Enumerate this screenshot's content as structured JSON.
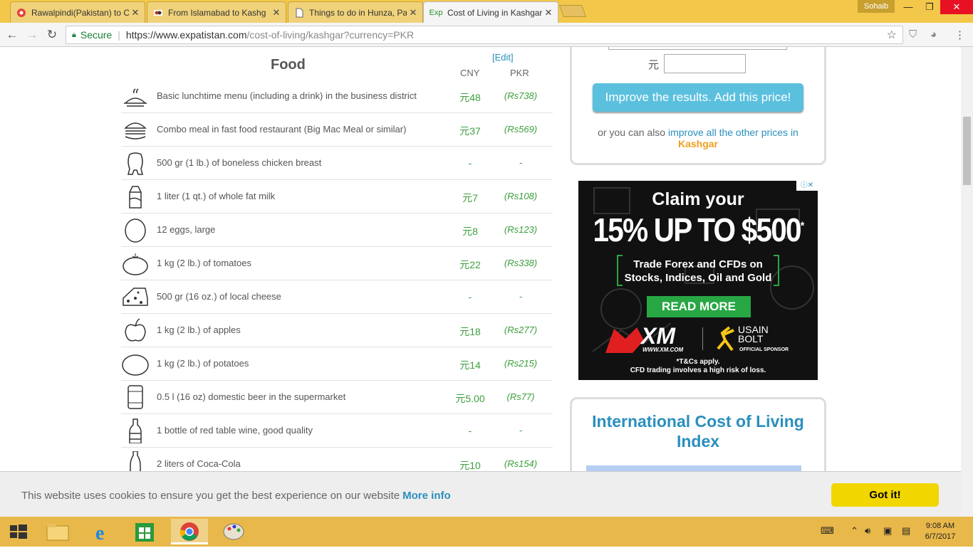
{
  "browser": {
    "tabs": [
      {
        "title": "Rawalpindi(Pakistan) to C",
        "icon": "rome2rio-icon"
      },
      {
        "title": "From Islamabad to Kashg",
        "icon": "blog-icon"
      },
      {
        "title": "Things to do in Hunza, Pa",
        "icon": "page-icon"
      },
      {
        "title": "Cost of Living in Kashgar",
        "icon": "expatistan-icon",
        "fav_text": "Exp"
      }
    ],
    "user": "Sohaib",
    "secure_label": "Secure",
    "url_base": "https://www.expatistan.com",
    "url_path": "/cost-of-living/kashgar?currency=PKR"
  },
  "food": {
    "title": "Food",
    "edit_label": "[Edit]",
    "col_cny": "CNY",
    "col_pkr": "PKR",
    "rows": [
      {
        "icon": "lunch-dish-icon",
        "label": "Basic lunchtime menu (including a drink) in the business district",
        "cny": "元48",
        "pkr": "(Rs738)"
      },
      {
        "icon": "burger-icon",
        "label": "Combo meal in fast food restaurant (Big Mac Meal or similar)",
        "cny": "元37",
        "pkr": "(Rs569)"
      },
      {
        "icon": "chicken-icon",
        "label": "500 gr (1 lb.) of boneless chicken breast",
        "cny": "-",
        "pkr": "-"
      },
      {
        "icon": "milk-carton-icon",
        "label": "1 liter (1 qt.) of whole fat milk",
        "cny": "元7",
        "pkr": "(Rs108)"
      },
      {
        "icon": "egg-icon",
        "label": "12 eggs, large",
        "cny": "元8",
        "pkr": "(Rs123)"
      },
      {
        "icon": "tomato-icon",
        "label": "1 kg (2 lb.) of tomatoes",
        "cny": "元22",
        "pkr": "(Rs338)"
      },
      {
        "icon": "cheese-icon",
        "label": "500 gr (16 oz.) of local cheese",
        "cny": "-",
        "pkr": "-"
      },
      {
        "icon": "apple-icon",
        "label": "1 kg (2 lb.) of apples",
        "cny": "元18",
        "pkr": "(Rs277)"
      },
      {
        "icon": "potato-icon",
        "label": "1 kg (2 lb.) of potatoes",
        "cny": "元14",
        "pkr": "(Rs215)"
      },
      {
        "icon": "beer-can-icon",
        "label": "0.5 l (16 oz) domestic beer in the supermarket",
        "cny": "元5.00",
        "pkr": "(Rs77)"
      },
      {
        "icon": "wine-bottle-icon",
        "label": "1 bottle of red table wine, good quality",
        "cny": "-",
        "pkr": "-"
      },
      {
        "icon": "cola-bottle-icon",
        "label": "2 liters of Coca-Cola",
        "cny": "元10",
        "pkr": "(Rs154)"
      }
    ]
  },
  "sidebar": {
    "currency_symbol": "元",
    "improve_button": "Improve the results. Add this price!",
    "other_prefix": "or you can also",
    "other_link": "improve all the other prices in",
    "city": "Kashgar",
    "index_title": "International Cost of Living Index"
  },
  "ad": {
    "line1": "Claim your",
    "line2": "15% UP TO $500",
    "asterisk": "*",
    "line3": "Trade Forex and CFDs on",
    "line4": "Stocks, Indices, Oil and Gold",
    "cta": "READ MORE",
    "brand": "XM",
    "brand_url": "WWW.XM.COM",
    "sponsor_name": "USAIN BOLT",
    "sponsor_label": "OFFICIAL SPONSOR",
    "disclaimer1": "*T&Cs apply.",
    "disclaimer2": "CFD trading involves a high risk of loss."
  },
  "cookie": {
    "text": "This website uses cookies to ensure you get the best experience on our website",
    "more": "More info",
    "button": "Got it!"
  },
  "taskbar": {
    "time": "9:08 AM",
    "date": "6/7/2017"
  },
  "colors": {
    "accent": "#2a8fbd",
    "price_green": "#3d9e3d",
    "button_blue": "#5bc0de",
    "cookie_yellow": "#f1d600",
    "city_orange": "#f0a020"
  }
}
